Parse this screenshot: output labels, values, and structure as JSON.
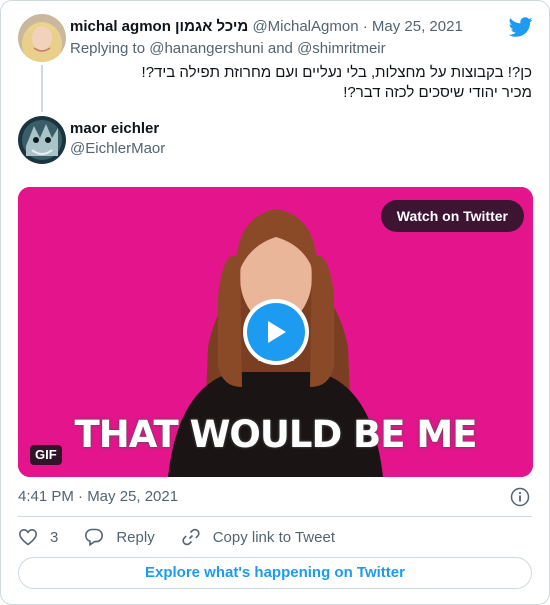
{
  "tweet": {
    "author_name": "michal agmon מיכל אגמון",
    "author_handle": "@MichalAgmon",
    "separator": "·",
    "date": "May 25, 2021",
    "replying_prefix": "Replying to",
    "reply_mention_1": "@hanangershuni",
    "reply_and": "and",
    "reply_mention_2": "@shimritmeir",
    "text_lines": [
      "כן?! בקבוצות על מחצלות, בלי נעליים ועם מחרוזת תפילה ביד?!",
      "מכיר יהודי שיסכים לכזה דבר?!"
    ]
  },
  "quoted": {
    "name": "maor eichler",
    "handle": "@EichlerMaor"
  },
  "media": {
    "watch_label": "Watch on Twitter",
    "caption": "THAT WOULD BE ME",
    "badge": "GIF",
    "background_color": "#e4148c"
  },
  "meta": {
    "timestamp": "4:41 PM · May 25, 2021"
  },
  "actions": {
    "like_count": "3",
    "reply_label": "Reply",
    "copy_label": "Copy link to Tweet"
  },
  "footer": {
    "explore_label": "Explore what's happening on Twitter"
  },
  "colors": {
    "accent": "#1d9bf0",
    "secondary_text": "#536471",
    "border": "#cfd9de"
  }
}
